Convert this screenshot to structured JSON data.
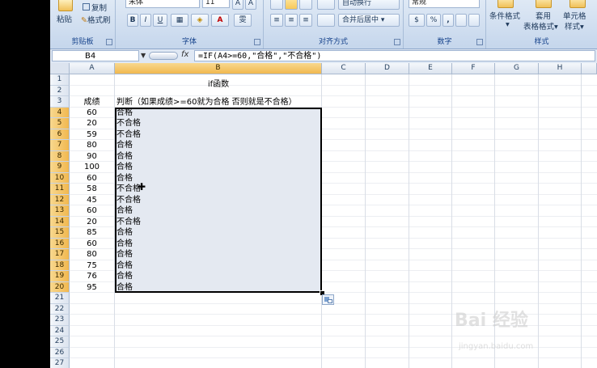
{
  "ribbon": {
    "clipboard": {
      "paste_label": "粘贴",
      "copy_label": "复制",
      "format_painter_label": "格式刷",
      "group_label": "剪贴板"
    },
    "font": {
      "font_name": "宋体",
      "font_size": "11",
      "bold": "B",
      "italic": "I",
      "underline": "U",
      "font_color_letter": "A",
      "phonetic_label": "雯",
      "group_label": "字体"
    },
    "alignment": {
      "wrap_label": "自动换行",
      "merge_label": "合并后居中",
      "group_label": "对齐方式"
    },
    "number": {
      "format_value": "常规",
      "percent": "%",
      "comma": ",",
      "group_label": "数字"
    },
    "styles": {
      "conditional_label": "条件格式",
      "table_format_label_1": "套用",
      "table_format_label_2": "表格格式",
      "cell_styles_label_1": "单元格",
      "cell_styles_label_2": "样式",
      "group_label": "样式"
    }
  },
  "formula_bar": {
    "name_box": "B4",
    "fx": "fx",
    "formula": "=IF(A4>=60,\"合格\",\"不合格\")"
  },
  "columns": [
    "A",
    "B",
    "C",
    "D",
    "E",
    "F",
    "G",
    "H"
  ],
  "rows": [
    "1",
    "2",
    "3",
    "4",
    "5",
    "6",
    "7",
    "8",
    "9",
    "10",
    "11",
    "12",
    "13",
    "14",
    "15",
    "16",
    "17",
    "18",
    "19",
    "20",
    "21",
    "22",
    "23",
    "24",
    "25",
    "26",
    "27"
  ],
  "sheet": {
    "title": "if函数",
    "header_a": "成绩",
    "header_b": "判断（如果成绩>=60就为合格 否则就是不合格）",
    "scores": [
      "60",
      "20",
      "59",
      "80",
      "90",
      "100",
      "60",
      "58",
      "45",
      "60",
      "20",
      "85",
      "60",
      "80",
      "75",
      "76",
      "95"
    ],
    "results": [
      "合格",
      "不合格",
      "不合格",
      "合格",
      "合格",
      "合格",
      "合格",
      "不合格",
      "不合格",
      "合格",
      "不合格",
      "合格",
      "合格",
      "合格",
      "合格",
      "合格",
      "合格"
    ]
  },
  "watermark": {
    "main": "Bai 经验",
    "sub": "jingyan.baidu.com"
  }
}
